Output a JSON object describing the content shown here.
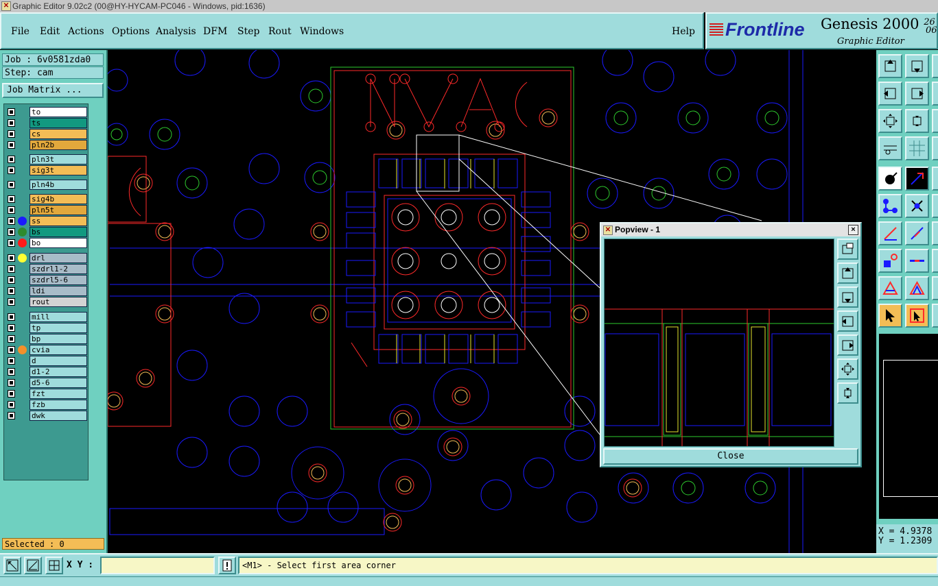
{
  "window": {
    "title": "Graphic Editor 9.02c2 (00@HY-HYCAM-PC046 - Windows, pid:1636)"
  },
  "menu": [
    "File",
    "Edit",
    "Actions",
    "Options",
    "Analysis",
    "DFM",
    "Step",
    "Rout",
    "Windows"
  ],
  "help_label": "Help",
  "brand": {
    "logo": "Frontline",
    "product": "Genesis 2000",
    "subtitle": "Graphic Editor",
    "date_top": "26",
    "date_bottom": "06"
  },
  "job": {
    "job_label": "Job : 6v0581zda0",
    "step_label": "Step: cam",
    "matrix_button": "Job Matrix ..."
  },
  "layers": [
    {
      "name": "to",
      "color": "#ffffff"
    },
    {
      "name": "ts",
      "color": "#129980"
    },
    {
      "name": "cs",
      "color": "#f3bd56"
    },
    {
      "name": "pln2b",
      "color": "#e2a83c"
    },
    {
      "name": "pln3t",
      "color": "#9fdcdc"
    },
    {
      "name": "sig3t",
      "color": "#f3bd56"
    },
    {
      "name": "pln4b",
      "color": "#9fdcdc"
    },
    {
      "name": "sig4b",
      "color": "#f3bd56"
    },
    {
      "name": "pln5t",
      "color": "#e2a83c"
    },
    {
      "name": "ss",
      "color": "#f3bd56",
      "dot": "#1a1aff"
    },
    {
      "name": "bs",
      "color": "#129980",
      "dot": "#2e8b2e"
    },
    {
      "name": "bo",
      "color": "#ffffff",
      "dot": "#ff1a1a"
    },
    {
      "name": "drl",
      "color": "#a8bcc8",
      "dot": "#ffff33"
    },
    {
      "name": "szdrl1-2",
      "color": "#a8bcc8"
    },
    {
      "name": "szdrl5-6",
      "color": "#a8bcc8"
    },
    {
      "name": "ldi",
      "color": "#a8bcc8"
    },
    {
      "name": "rout",
      "color": "#d3d3d3"
    },
    {
      "name": "mill",
      "color": "#9fdcdc"
    },
    {
      "name": "tp",
      "color": "#9fdcdc"
    },
    {
      "name": "bp",
      "color": "#9fdcdc"
    },
    {
      "name": "cvia",
      "color": "#9fdcdc",
      "dot": "#f3902a"
    },
    {
      "name": "d",
      "color": "#9fdcdc"
    },
    {
      "name": "d1-2",
      "color": "#9fdcdc"
    },
    {
      "name": "d5-6",
      "color": "#9fdcdc"
    },
    {
      "name": "fzt",
      "color": "#9fdcdc"
    },
    {
      "name": "fzb",
      "color": "#9fdcdc"
    },
    {
      "name": "dwk",
      "color": "#9fdcdc"
    }
  ],
  "selected_label": "Selected : 0",
  "xy_label": "X Y :",
  "xy_value": "",
  "message": "<M1> - Select first area corner",
  "coords": {
    "x": "X = 4.9378",
    "y": "Y = 1.2309"
  },
  "popview": {
    "title": "Popview - 1",
    "close_button": "Close",
    "close_x": "×"
  },
  "colors": {
    "panel": "#9fdcdc",
    "panel_dark": "#6fd0c0",
    "highlight": "#f3bd56",
    "canvas": "#000000"
  }
}
